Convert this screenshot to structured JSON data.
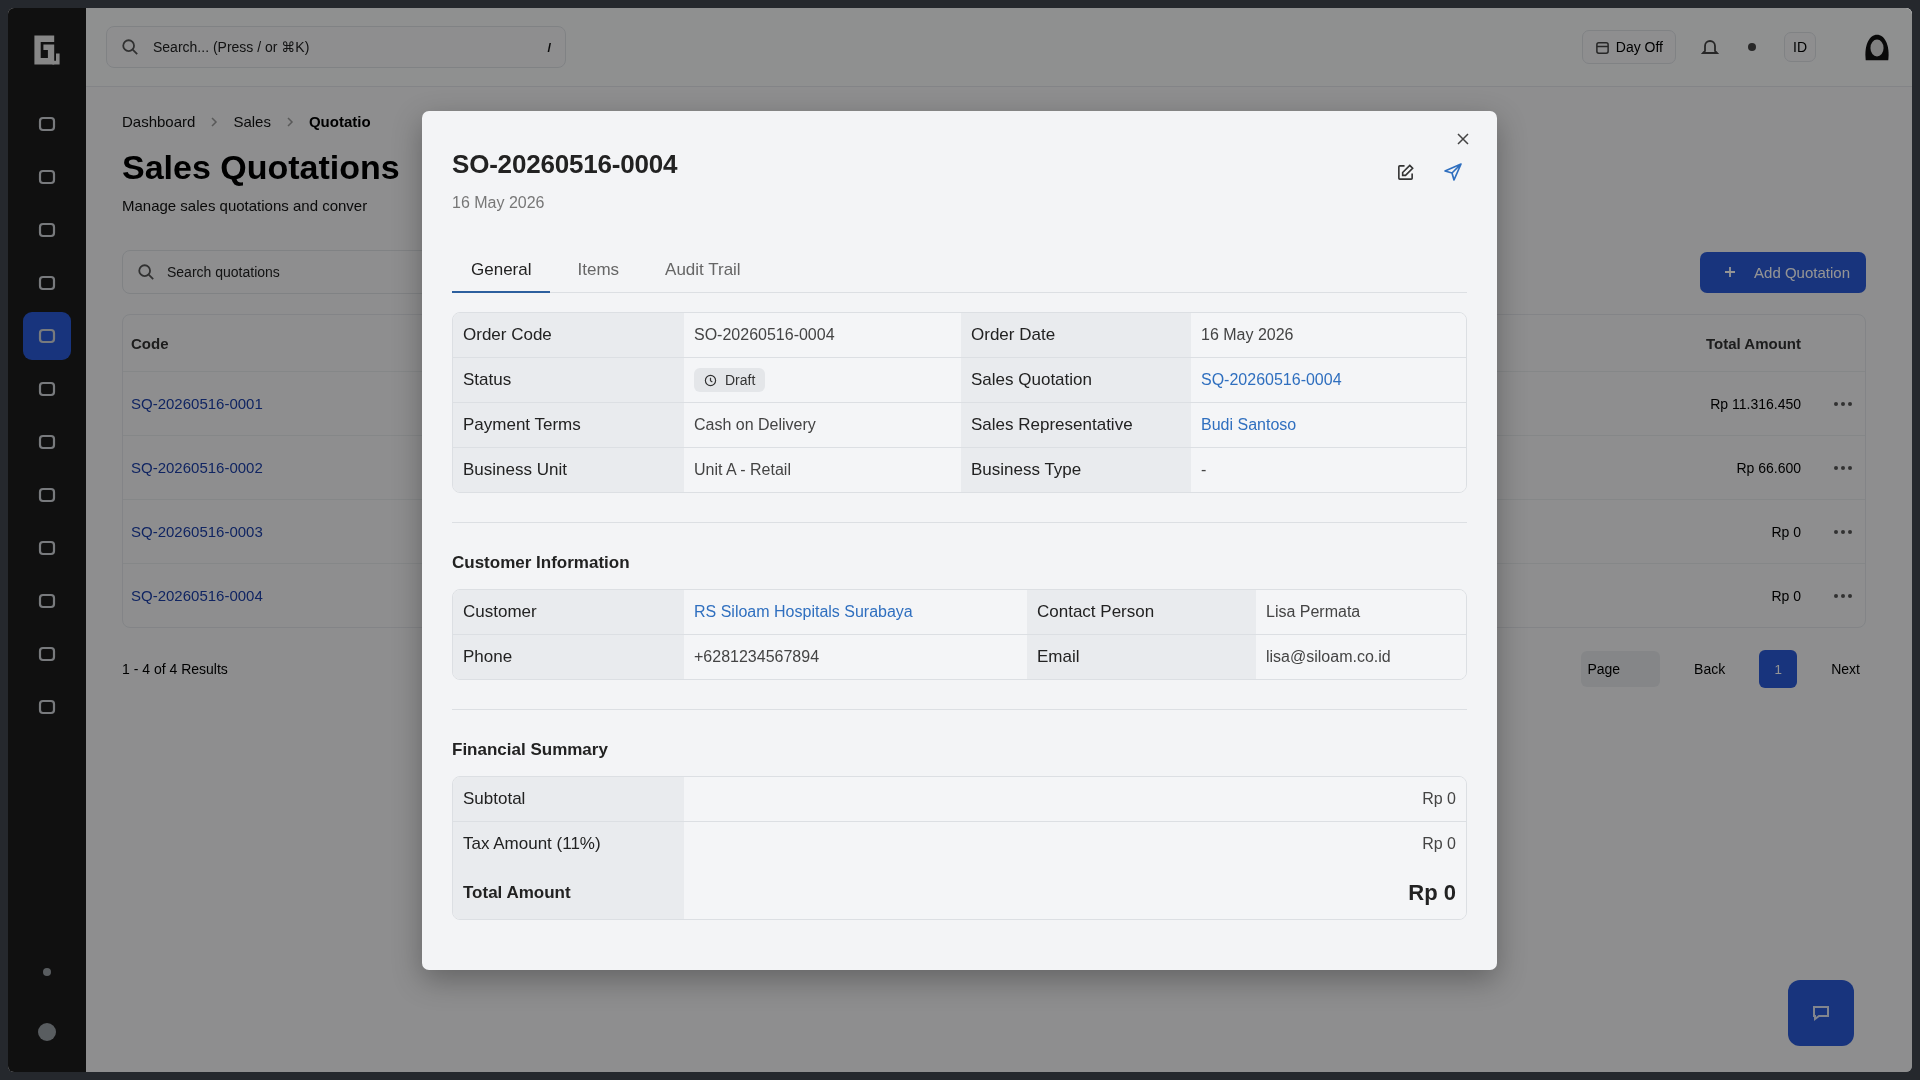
{
  "topbar": {
    "search_placeholder": "Search... (Press / or ⌘K)",
    "shortcut": "/",
    "day_off": "Day Off",
    "lang": "ID"
  },
  "sidebar": {
    "items": [
      {
        "selected": false
      },
      {
        "selected": false
      },
      {
        "selected": false
      },
      {
        "selected": false
      },
      {
        "selected": true
      },
      {
        "selected": false
      },
      {
        "selected": false
      },
      {
        "selected": false
      },
      {
        "selected": false
      },
      {
        "selected": false
      },
      {
        "selected": false
      },
      {
        "selected": false
      }
    ]
  },
  "breadcrumb": [
    "Dashboard",
    "Sales",
    "Quotatio"
  ],
  "page": {
    "title": "Sales Quotations",
    "subtitle": "Manage sales quotations and conver",
    "search_placeholder": "Search quotations",
    "add_button": "Add Quotation"
  },
  "table": {
    "columns": [
      "Code",
      "Total Amount"
    ],
    "rows": [
      {
        "code": "SQ-20260516-0001",
        "total": "Rp 11.316.450"
      },
      {
        "code": "SQ-20260516-0002",
        "total": "Rp 66.600"
      },
      {
        "code": "SQ-20260516-0003",
        "total": "Rp 0"
      },
      {
        "code": "SQ-20260516-0004",
        "total": "Rp 0"
      }
    ]
  },
  "pagination": {
    "results": "1 - 4 of 4 Results",
    "per_page": "Page",
    "back": "Back",
    "pages": [
      {
        "label": "1",
        "selected": true
      }
    ],
    "next": "Next"
  },
  "modal": {
    "title": "SO-20260516-0004",
    "date": "16 May 2026",
    "tabs": [
      {
        "label": "General",
        "selected": true
      },
      {
        "label": "Items",
        "selected": false
      },
      {
        "label": "Audit Trail",
        "selected": false
      }
    ],
    "details": [
      {
        "cells": [
          {
            "label": "Order Code",
            "value": "SO-20260516-0004",
            "kind": "text"
          },
          {
            "label": "Order Date",
            "value": "16 May 2026",
            "kind": "text"
          }
        ]
      },
      {
        "cells": [
          {
            "label": "Status",
            "value": "Draft",
            "kind": "badge"
          },
          {
            "label": "Sales Quotation",
            "value": "SQ-20260516-0004",
            "kind": "link"
          }
        ]
      },
      {
        "cells": [
          {
            "label": "Payment Terms",
            "value": "Cash on Delivery",
            "kind": "text"
          },
          {
            "label": "Sales Representative",
            "value": "Budi Santoso",
            "kind": "link"
          }
        ]
      },
      {
        "cells": [
          {
            "label": "Business Unit",
            "value": "Unit A - Retail",
            "kind": "text"
          },
          {
            "label": "Business Type",
            "value": "-",
            "kind": "text"
          }
        ]
      }
    ],
    "customer": {
      "heading": "Customer Information",
      "rows": [
        {
          "cells": [
            {
              "label": "Customer",
              "value": "RS Siloam Hospitals Surabaya",
              "kind": "link"
            },
            {
              "label": "Contact Person",
              "value": "Lisa Permata",
              "kind": "text"
            }
          ]
        },
        {
          "cells": [
            {
              "label": "Phone",
              "value": "+6281234567894",
              "kind": "text"
            },
            {
              "label": "Email",
              "value": "lisa@siloam.co.id",
              "kind": "text"
            }
          ]
        }
      ]
    },
    "financial": {
      "heading": "Financial Summary",
      "rows": [
        {
          "label": "Subtotal",
          "value": "Rp 0",
          "total": false
        },
        {
          "label": "Tax Amount (11%)",
          "value": "Rp 0",
          "total": false
        },
        {
          "label": "Total Amount",
          "value": "Rp 0",
          "total": true
        }
      ]
    }
  }
}
